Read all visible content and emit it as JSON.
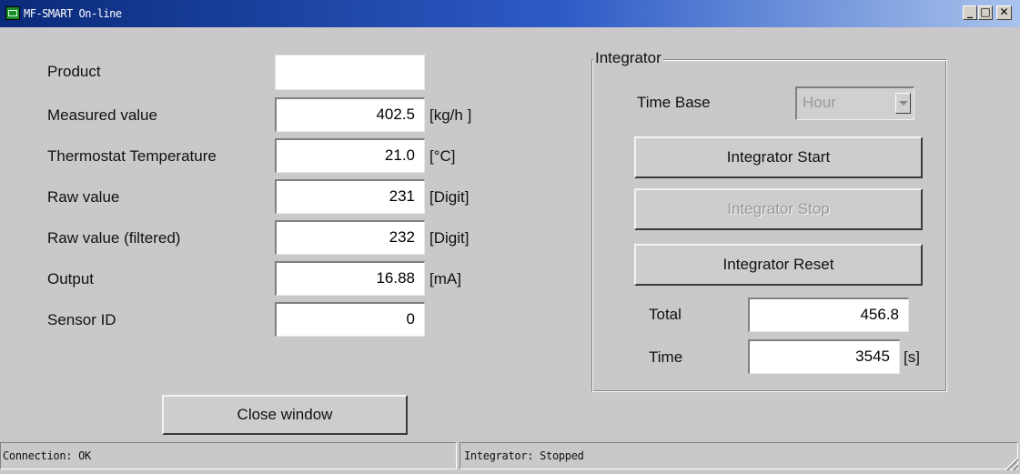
{
  "window": {
    "title": "MF-SMART On-line",
    "minimize": "_",
    "maximize": "□",
    "close": "✕"
  },
  "fields": [
    {
      "label": "Product",
      "value": "",
      "unit": ""
    },
    {
      "label": "Measured value",
      "value": "402.5",
      "unit": "[kg/h ]"
    },
    {
      "label": "Thermostat Temperature",
      "value": "21.0",
      "unit": "[°C]"
    },
    {
      "label": "Raw value",
      "value": "231",
      "unit": "[Digit]"
    },
    {
      "label": "Raw value (filtered)",
      "value": "232",
      "unit": "[Digit]"
    },
    {
      "label": "Output",
      "value": "16.88",
      "unit": "[mA]"
    },
    {
      "label": "Sensor ID",
      "value": "0",
      "unit": ""
    }
  ],
  "close_button": "Close window",
  "integrator": {
    "title": "Integrator",
    "time_base_label": "Time Base",
    "time_base_value": "Hour",
    "start_label": "Integrator Start",
    "stop_label": "Integrator Stop",
    "reset_label": "Integrator Reset",
    "total_label": "Total",
    "total_value": "456.8",
    "time_label": "Time",
    "time_value": "3545",
    "time_unit": "[s]"
  },
  "status": {
    "connection": "Connection: OK",
    "integrator": "Integrator: Stopped"
  },
  "colors": {
    "titlebar_start": "#0a2a7a",
    "titlebar_end": "#a9c3ec",
    "face": "#cbc8cb",
    "disabled_text": "#9a979a"
  }
}
